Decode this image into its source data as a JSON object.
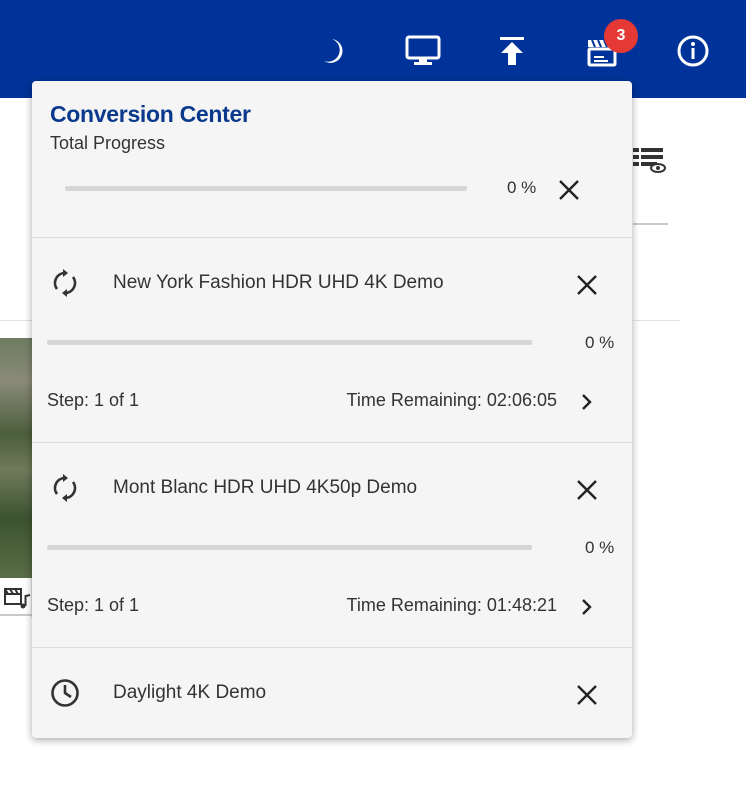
{
  "topbar": {
    "background": "#003399",
    "icons": [
      "moon-icon",
      "monitor-icon",
      "upload-icon",
      "clapperboard-icon",
      "info-icon"
    ],
    "badge_count": "3"
  },
  "panel": {
    "title": "Conversion Center",
    "subtitle": "Total Progress",
    "total_percent": "0 %",
    "total_progress": 0,
    "jobs": [
      {
        "status_icon": "sync-icon",
        "title": "New York Fashion HDR UHD 4K Demo",
        "percent": "0 %",
        "progress": 0,
        "step": "Step: 1 of 1",
        "time_remaining": "Time Remaining: 02:06:05"
      },
      {
        "status_icon": "sync-icon",
        "title": "Mont Blanc HDR UHD 4K50p Demo",
        "percent": "0 %",
        "progress": 0,
        "step": "Step: 1 of 1",
        "time_remaining": "Time Remaining: 01:48:21"
      },
      {
        "status_icon": "clock-icon",
        "title": "Daylight 4K Demo"
      }
    ]
  },
  "colors": {
    "accent": "#0b3a8c",
    "badge": "#e53935",
    "panel_bg": "#f5f5f5",
    "progress_track": "#d6d6d6"
  }
}
